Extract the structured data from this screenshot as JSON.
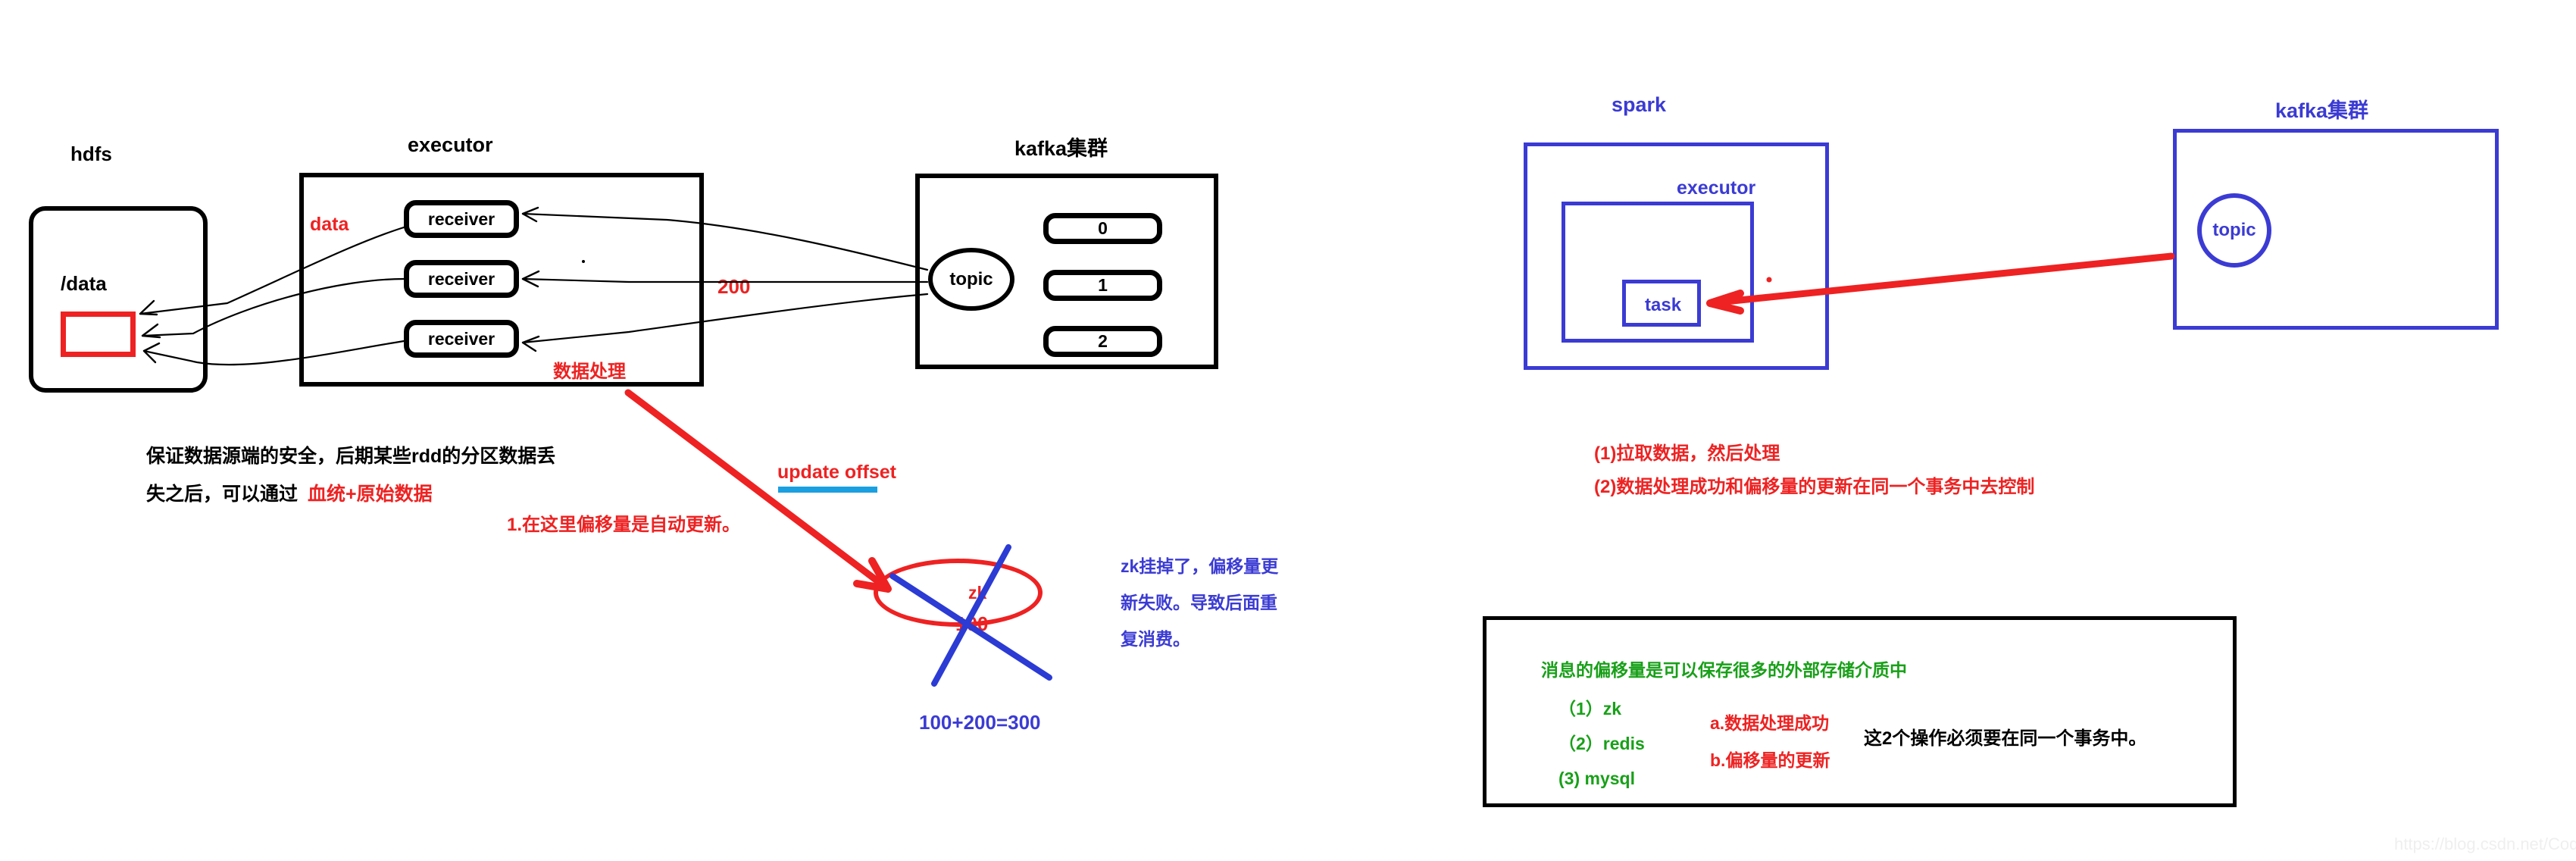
{
  "watermark": "https://blog.csdn.net/CoderBoom",
  "left_diagram": {
    "hdfs": {
      "title": "hdfs",
      "path_label": "/data"
    },
    "executor": {
      "title": "executor",
      "receivers": [
        "receiver",
        "receiver",
        "receiver"
      ],
      "data_label": "data",
      "process_label": "数据处理"
    },
    "kafka": {
      "title": "kafka集群",
      "topic_label": "topic",
      "partitions": [
        "0",
        "1",
        "2"
      ]
    },
    "offset_label": "200",
    "notes": {
      "line1": "保证数据源端的安全，后期某些rdd的分区数据丢",
      "line2_black": "失之后，可以通过",
      "line2_red": "血统+原始数据",
      "auto_update": "1.在这里偏移量是自动更新。",
      "update_offset": "update offset"
    },
    "zk_circle": {
      "zk_label": "zk",
      "value": "100",
      "sum_expression": "100+200=300",
      "explain_line1": "zk挂掉了，偏移量更",
      "explain_line2": "新失败。导致后面重",
      "explain_line3": "复消费。"
    }
  },
  "right_diagram": {
    "spark": {
      "title": "spark",
      "executor_title": "executor",
      "task_label": "task"
    },
    "kafka": {
      "title": "kafka集群",
      "topic_label": "topic"
    },
    "notes": {
      "line1": "(1)拉取数据，然后处理",
      "line2": "(2)数据处理成功和偏移量的更新在同一个事务中去控制"
    },
    "storage_box": {
      "heading": "消息的偏移量是可以保存很多的外部存储介质中",
      "items": [
        "（1）zk",
        "（2）redis",
        "(3) mysql"
      ],
      "ops": [
        "a.数据处理成功",
        "b.偏移量的更新"
      ],
      "conclusion": "这2个操作必须要在同一个事务中。"
    }
  },
  "colors": {
    "red": "#ee2222",
    "blue": "#3b3bd4",
    "green": "#18a018",
    "black": "#000000",
    "cyan_underline": "#1a9fe0"
  }
}
